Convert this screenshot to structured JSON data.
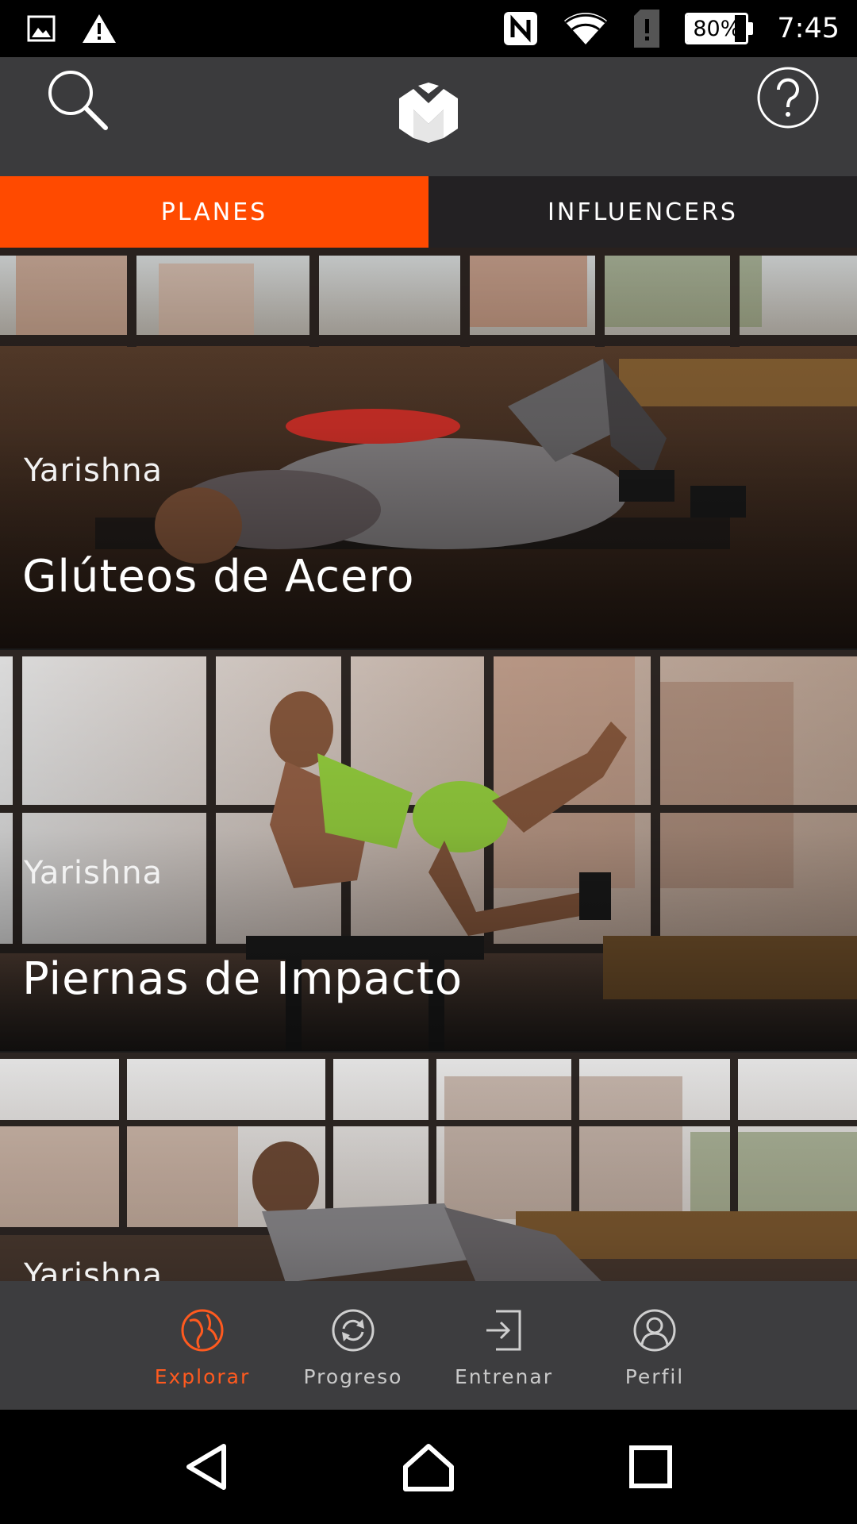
{
  "status_bar": {
    "time": "7:45",
    "battery": "80%",
    "battery_level": 0.8,
    "icons": [
      "image-icon",
      "warning-icon",
      "nfc-icon",
      "wifi-icon",
      "sim-alert-icon",
      "battery-icon"
    ]
  },
  "header": {
    "search_icon": "search-icon",
    "logo_icon": "app-logo-icon",
    "help_icon": "help-icon"
  },
  "tabs": [
    {
      "label": "PLANES",
      "active": true
    },
    {
      "label": "INFLUENCERS",
      "active": false
    }
  ],
  "cards": [
    {
      "author": "Yarishna",
      "title": "Glúteos de Acero"
    },
    {
      "author": "Yarishna",
      "title": "Piernas de Impacto"
    },
    {
      "author": "Yarishna",
      "title": ""
    }
  ],
  "bottom_nav": [
    {
      "label": "Explorar",
      "icon": "globe-icon",
      "active": true
    },
    {
      "label": "Progreso",
      "icon": "refresh-icon",
      "active": false
    },
    {
      "label": "Entrenar",
      "icon": "enter-icon",
      "active": false
    },
    {
      "label": "Perfil",
      "icon": "user-icon",
      "active": false
    }
  ],
  "colors": {
    "accent": "#ff4a00",
    "header_bg": "#3b3b3d",
    "tab_inactive_bg": "#232123",
    "nav_bg": "#3d3d3f"
  }
}
